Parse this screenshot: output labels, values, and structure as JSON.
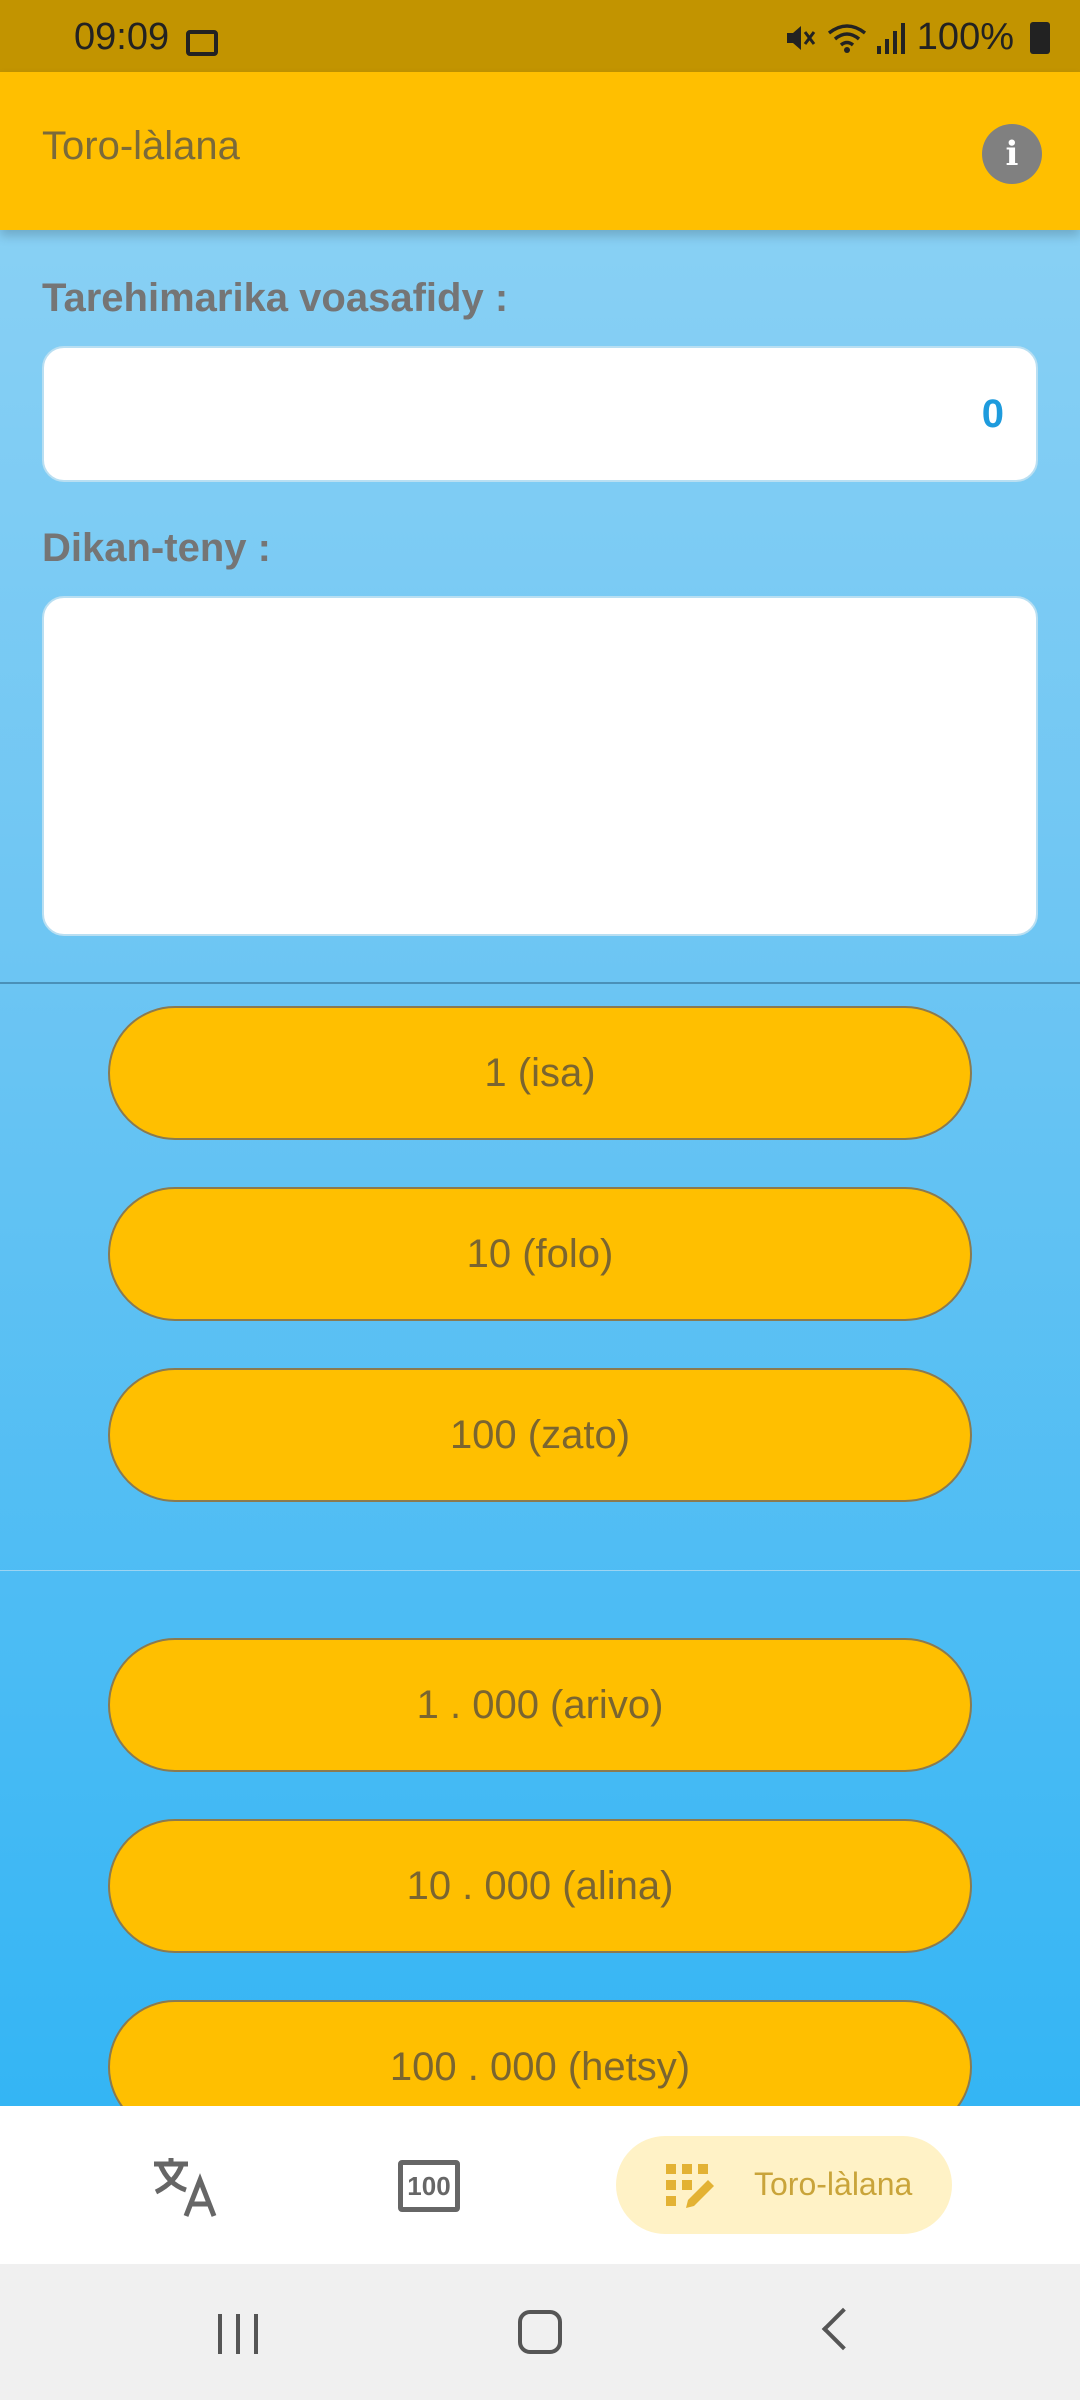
{
  "status_bar": {
    "time": "09:09",
    "battery": "100%"
  },
  "app_bar": {
    "title": "Toro-làlana",
    "info_icon": "info-icon",
    "info_glyph": "i"
  },
  "form": {
    "number_label": "Tarehimarika voasafidy :",
    "number_value": "0",
    "words_label": "Dikan-teny :",
    "words_value": ""
  },
  "buttons": [
    "1 (isa)",
    "10 (folo)",
    "100 (zato)",
    "1 . 000 (arivo)",
    "10 . 000 (alina)",
    "100 . 000 (hetsy)"
  ],
  "bottom_nav": {
    "items": [
      {
        "icon": "translate-icon"
      },
      {
        "icon": "numbers-icon",
        "glyph": "100"
      },
      {
        "icon": "edit-grid-icon",
        "label": "Toro-làlana"
      }
    ]
  },
  "colors": {
    "accent": "#FFBF00",
    "status_bar": "#C29400",
    "content_top": "#88d0f4",
    "content_bottom": "#34b5f4"
  }
}
